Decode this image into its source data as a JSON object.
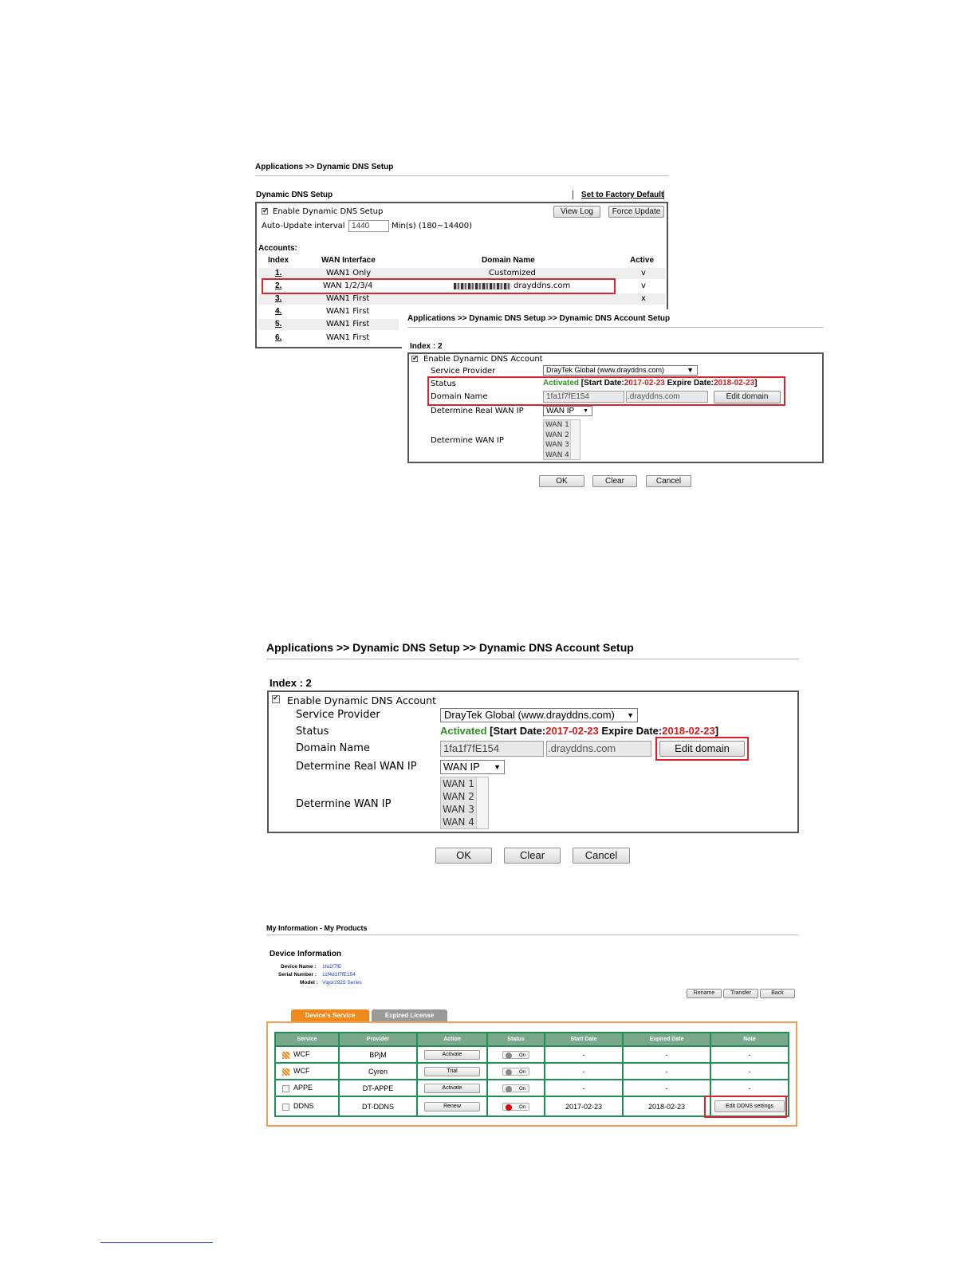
{
  "shot1": {
    "breadcrumb": "Applications >> Dynamic DNS Setup",
    "section_title": "Dynamic DNS Setup",
    "factory_default": "Set to Factory Default",
    "enable_label": "Enable Dynamic DNS Setup",
    "view_log": "View Log",
    "force_update": "Force Update",
    "interval_label": "Auto-Update interval",
    "interval_value": "1440",
    "interval_unit": "Min(s) (180~14400)",
    "accounts_label": "Accounts:",
    "columns": [
      "Index",
      "WAN Interface",
      "Domain Name",
      "Active"
    ],
    "rows": [
      {
        "index": "1.",
        "wan": "WAN1 Only",
        "domain": "Customized",
        "active": "v"
      },
      {
        "index": "2.",
        "wan": "WAN 1/2/3/4",
        "domain": "drayddns.com",
        "active": "v"
      },
      {
        "index": "3.",
        "wan": "WAN1 First",
        "domain": "",
        "active": "x"
      },
      {
        "index": "4.",
        "wan": "WAN1 First",
        "domain": "",
        "active": ""
      },
      {
        "index": "5.",
        "wan": "WAN1 First",
        "domain": "",
        "active": ""
      },
      {
        "index": "6.",
        "wan": "WAN1 First",
        "domain": "",
        "active": ""
      }
    ]
  },
  "account_small": {
    "breadcrumb": "Applications >> Dynamic DNS Setup >> Dynamic DNS Account Setup",
    "index_label": "Index : 2",
    "enable_label": "Enable Dynamic DNS Account",
    "service_provider_label": "Service Provider",
    "service_provider_value": "DrayTek Global (www.drayddns.com)",
    "status_label": "Status",
    "status_activated": "Activated",
    "status_start_label": "[Start Date:",
    "status_start": "2017-02-23",
    "status_expire_label": "Expire Date:",
    "status_expire": "2018-02-23",
    "status_end": "]",
    "domain_label": "Domain Name",
    "domain_host": "1fa1f7fE154",
    "domain_suffix": ".drayddns.com",
    "edit_domain": "Edit domain",
    "real_wan_label": "Determine Real WAN IP",
    "real_wan_value": "WAN IP",
    "wan_ip_label": "Determine WAN IP",
    "wan_list": [
      "WAN 1",
      "WAN 2",
      "WAN 3",
      "WAN 4"
    ],
    "ok": "OK",
    "clear": "Clear",
    "cancel": "Cancel"
  },
  "account_large": {
    "breadcrumb": "Applications >> Dynamic DNS Setup >> Dynamic DNS Account Setup",
    "index_label": "Index : 2",
    "enable_label": "Enable Dynamic DNS Account",
    "service_provider_label": "Service Provider",
    "service_provider_value": "DrayTek Global (www.drayddns.com)",
    "status_label": "Status",
    "status_activated": "Activated",
    "status_start_label": "[Start Date:",
    "status_start": "2017-02-23",
    "status_expire_label": "Expire Date:",
    "status_expire": "2018-02-23",
    "status_end": "]",
    "domain_label": "Domain Name",
    "domain_host": "1fa1f7fE154",
    "domain_suffix": ".drayddns.com",
    "edit_domain": "Edit domain",
    "real_wan_label": "Determine Real WAN IP",
    "real_wan_value": "WAN IP",
    "wan_ip_label": "Determine WAN IP",
    "wan_list": [
      "WAN 1",
      "WAN 2",
      "WAN 3",
      "WAN 4"
    ],
    "ok": "OK",
    "clear": "Clear",
    "cancel": "Cancel"
  },
  "products": {
    "breadcrumb": "My Information - My Products",
    "device_info_title": "Device Information",
    "device_name_label": "Device Name :",
    "device_name": "1fa1f7fE",
    "serial_label": "Serial Number :",
    "serial": "11f4d1f7fE154",
    "model_label": "Model :",
    "model": "Vigor2925 Series",
    "rename": "Rename",
    "transfer": "Transfer",
    "back": "Back",
    "tab_service": "Device's Service",
    "tab_expired": "Expired License",
    "columns": [
      "Service",
      "Provider",
      "Action",
      "Status",
      "Start Date",
      "Expired Date",
      "Note"
    ],
    "rows": [
      {
        "service": "WCF",
        "provider": "BPjM",
        "action": "Activate",
        "status": "On",
        "start": "-",
        "expired": "-",
        "note": "-",
        "icon": "wcf-icon",
        "active": false
      },
      {
        "service": "WCF",
        "provider": "Cyren",
        "action": "Trial",
        "status": "On",
        "start": "-",
        "expired": "-",
        "note": "-",
        "icon": "wcf-icon",
        "active": false
      },
      {
        "service": "APPE",
        "provider": "DT-APPE",
        "action": "Activate",
        "status": "On",
        "start": "-",
        "expired": "-",
        "note": "-",
        "icon": "image-icon",
        "active": false
      },
      {
        "service": "DDNS",
        "provider": "DT-DDNS",
        "action": "Renew",
        "status": "On",
        "start": "2017-02-23",
        "expired": "2018-02-23",
        "note": "Edit DDNS settings",
        "icon": "image-icon",
        "active": true
      }
    ]
  },
  "colors": {
    "accent_red": "#d9232d",
    "status_green": "#2f8f1f",
    "table_green": "#1f8f52",
    "tab_orange": "#f08a1c",
    "tab_gray": "#9a9a9a"
  }
}
